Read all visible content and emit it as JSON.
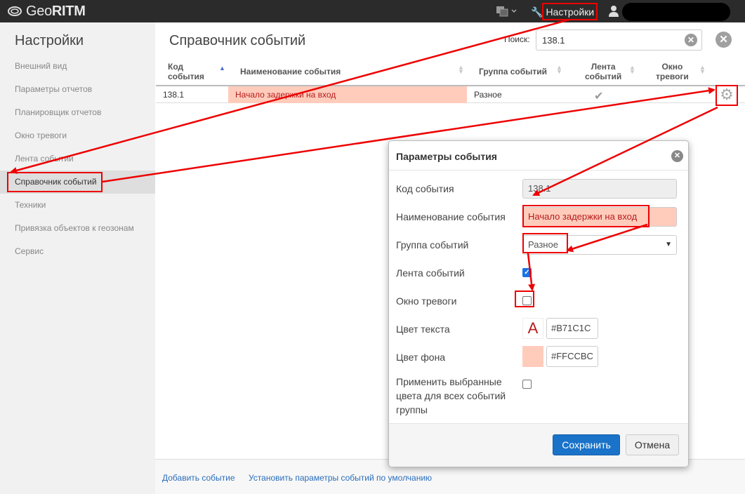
{
  "app": {
    "logo_prefix": "Geo",
    "logo_bold": "RITM",
    "lang_icon": "translate-icon",
    "settings_label": "Настройки"
  },
  "sidebar": {
    "title": "Настройки",
    "items": [
      {
        "label": "Внешний вид"
      },
      {
        "label": "Параметры отчетов"
      },
      {
        "label": "Планировщик отчетов"
      },
      {
        "label": "Окно тревоги"
      },
      {
        "label": "Лента событий"
      },
      {
        "label": "Справочник событий",
        "active": true
      },
      {
        "label": "Техники"
      },
      {
        "label": "Привязка объектов к геозонам"
      },
      {
        "label": "Сервис"
      }
    ]
  },
  "main": {
    "title": "Справочник событий",
    "search_label": "Поиск:",
    "search_value": "138.1",
    "table": {
      "columns": [
        {
          "label_1": "Код",
          "label_2": "события"
        },
        {
          "label": "Наименование события"
        },
        {
          "label": "Группа событий"
        },
        {
          "label_1": "Лента",
          "label_2": "событий"
        },
        {
          "label_1": "Окно",
          "label_2": "тревоги"
        }
      ],
      "rows": [
        {
          "code": "138.1",
          "name": "Начало задержки на вход",
          "group": "Разное",
          "feed": true,
          "alarm": false
        }
      ]
    },
    "footer": {
      "add_event": "Добавить событие",
      "set_defaults": "Установить параметры событий по умолчанию"
    }
  },
  "modal": {
    "title": "Параметры события",
    "fields": {
      "code_label": "Код события",
      "code_value": "138.1",
      "name_label": "Наименование события",
      "name_value": "Начало задержки на вход",
      "group_label": "Группа событий",
      "group_value": "Разное",
      "feed_label": "Лента событий",
      "feed_checked": true,
      "alarm_label": "Окно тревоги",
      "alarm_checked": false,
      "text_color_label": "Цвет текста",
      "text_color_swatch": "A",
      "text_color_value": "#B71C1C",
      "bg_color_label": "Цвет фона",
      "bg_color_value": "#FFCCBC",
      "apply_all_label_1": "Применить выбранные",
      "apply_all_label_2": "цвета для всех событий",
      "apply_all_label_3": "группы",
      "apply_all_checked": false
    },
    "save_label": "Сохранить",
    "cancel_label": "Отмена"
  },
  "colors": {
    "accent": "#1a73c9",
    "highlight_text": "#b71c1c",
    "highlight_bg": "#ffccbc",
    "annotation": "#ee0000"
  }
}
